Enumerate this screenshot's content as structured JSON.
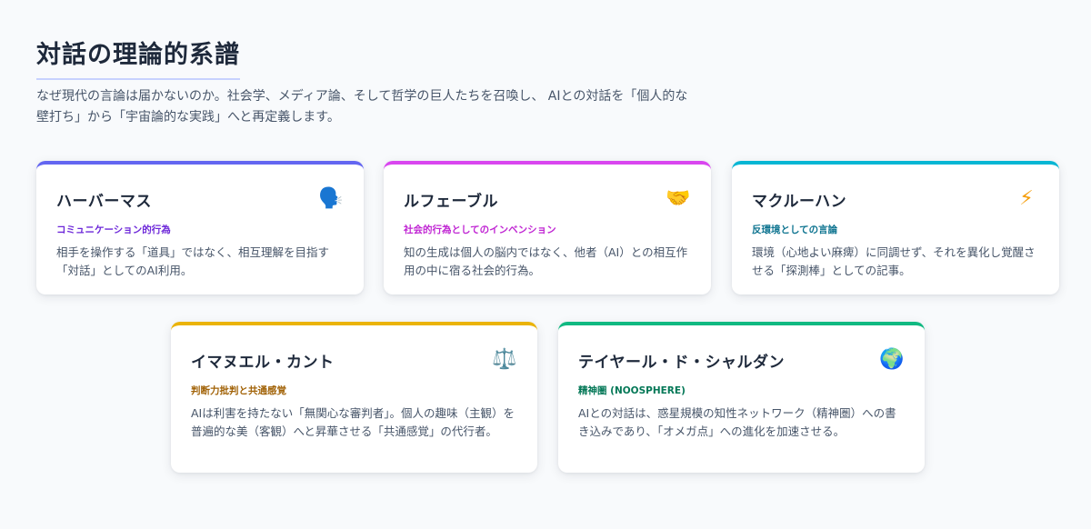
{
  "header": {
    "title": "対話の理論的系譜",
    "intro": "なぜ現代の言論は届かないのか。社会学、メディア論、そして哲学の巨人たちを召喚し、 AIとの対話を「個人的な壁打ち」から「宇宙論的な実践」へと再定義します。"
  },
  "cards": [
    {
      "name": "ハーバーマス",
      "icon": "🗣️",
      "icon_name": "speaking-head-icon",
      "tag": "コミュニケーション的行為",
      "description": "相手を操作する「道具」ではなく、相互理解を目指す「対話」としてのAI利用。",
      "accent": "#6366f1"
    },
    {
      "name": "ルフェーブル",
      "icon": "🤝",
      "icon_name": "handshake-icon",
      "tag": "社会的行為としてのインベンション",
      "description": "知の生成は個人の脳内ではなく、他者（AI）との相互作用の中に宿る社会的行為。",
      "accent": "#d946ef"
    },
    {
      "name": "マクルーハン",
      "icon": "⚡",
      "icon_name": "lightning-icon",
      "tag": "反環境としての言論",
      "description": "環境（心地よい麻痺）に同調せず、それを異化し覚醒させる「探測棒」としての記事。",
      "accent": "#06b6d4"
    },
    {
      "name": "イマヌエル・カント",
      "icon": "⚖️",
      "icon_name": "balance-scale-icon",
      "tag": "判断力批判と共通感覚",
      "description": "AIは利害を持たない「無関心な審判者」。個人の趣味（主観）を普遍的な美（客観）へと昇華させる「共通感覚」の代行者。",
      "accent": "#eab308"
    },
    {
      "name": "テイヤール・ド・シャルダン",
      "icon": "🌍",
      "icon_name": "globe-icon",
      "tag": "精神圏 (NOOSPHERE)",
      "description": "AIとの対話は、惑星規模の知性ネットワーク（精神圏）への書き込みであり、「オメガ点」への進化を加速させる。",
      "accent": "#10b981"
    }
  ]
}
